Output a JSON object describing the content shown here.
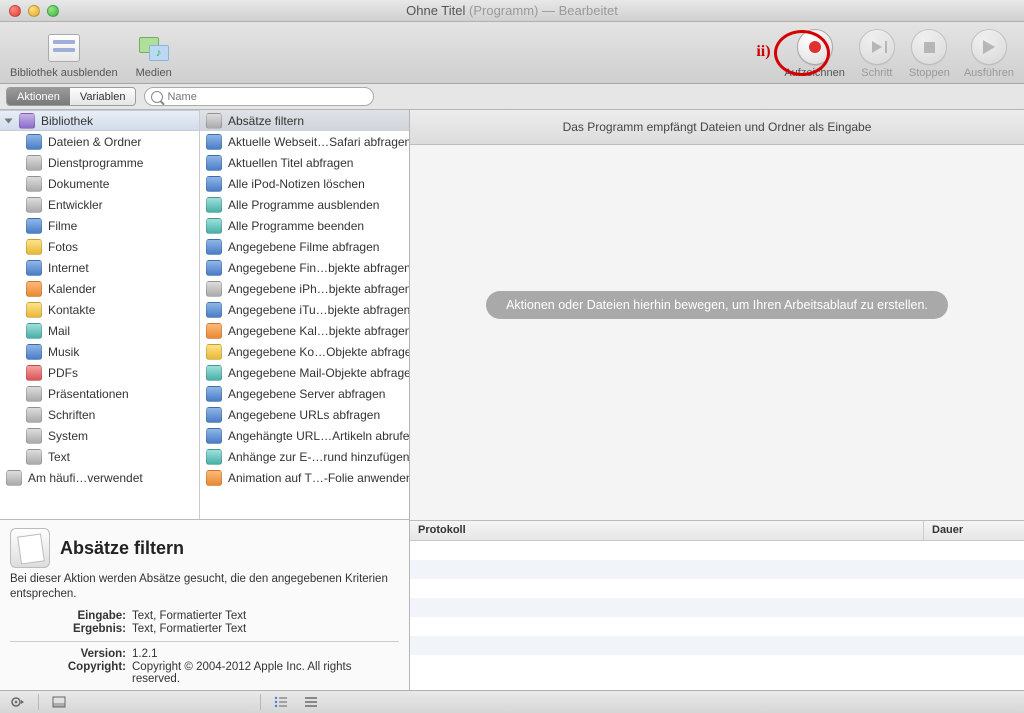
{
  "window": {
    "title_main": "Ohne Titel",
    "title_paren": "(Programm)",
    "title_state": "— Bearbeitet"
  },
  "annotation": {
    "label": "ii)"
  },
  "toolbar": {
    "hide_library": "Bibliothek ausblenden",
    "media": "Medien",
    "record": "Aufzeichnen",
    "step": "Schritt",
    "stop": "Stoppen",
    "run": "Ausführen"
  },
  "tabs": {
    "actions": "Aktionen",
    "variables": "Variablen"
  },
  "search": {
    "placeholder": "Name"
  },
  "library": {
    "header": "Bibliothek",
    "categories": [
      "Dateien & Ordner",
      "Dienstprogramme",
      "Dokumente",
      "Entwickler",
      "Filme",
      "Fotos",
      "Internet",
      "Kalender",
      "Kontakte",
      "Mail",
      "Musik",
      "PDFs",
      "Präsentationen",
      "Schriften",
      "System",
      "Text"
    ],
    "footer_item": "Am häufi…verwendet"
  },
  "actions": [
    "Absätze filtern",
    "Aktuelle Webseit…Safari abfragen",
    "Aktuellen Titel abfragen",
    "Alle iPod-Notizen löschen",
    "Alle Programme ausblenden",
    "Alle Programme beenden",
    "Angegebene Filme abfragen",
    "Angegebene Fin…bjekte abfragen",
    "Angegebene iPh…bjekte abfragen",
    "Angegebene iTu…bjekte abfragen",
    "Angegebene Kal…bjekte abfragen",
    "Angegebene Ko…Objekte abfragen",
    "Angegebene Mail-Objekte abfragen",
    "Angegebene Server abfragen",
    "Angegebene URLs abfragen",
    "Angehängte URL…Artikeln abrufen",
    "Anhänge zur E-…rund hinzufügen",
    "Animation auf T…-Folie anwenden"
  ],
  "info": {
    "title": "Absätze filtern",
    "desc": "Bei dieser Aktion werden Absätze gesucht, die den angegebenen Kriterien entsprechen.",
    "input_k": "Eingabe:",
    "input_v": "Text, Formatierter Text",
    "result_k": "Ergebnis:",
    "result_v": "Text, Formatierter Text",
    "version_k": "Version:",
    "version_v": "1.2.1",
    "copyright_k": "Copyright:",
    "copyright_v": "Copyright © 2004-2012 Apple Inc.  All rights reserved."
  },
  "workflow": {
    "input_hint": "Das Programm empfängt Dateien und Ordner als Eingabe",
    "placeholder": "Aktionen oder Dateien hierhin bewegen, um Ihren Arbeitsablauf zu erstellen."
  },
  "log": {
    "col_protocol": "Protokoll",
    "col_duration": "Dauer"
  }
}
